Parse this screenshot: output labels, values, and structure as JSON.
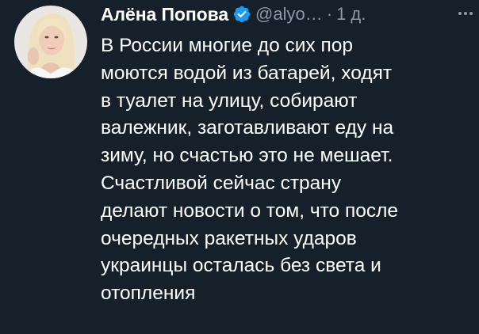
{
  "tweet": {
    "author": {
      "name": "Алёна Попова",
      "handle": "@alyo…",
      "verified": true,
      "avatar_icon": "profile-photo"
    },
    "separator": "·",
    "time": "1 д.",
    "more_icon": "more-horizontal-icon",
    "text_lines": [
      "В России многие до сих пор",
      "моются водой из батарей, ходят",
      "в туалет на улицу, собирают",
      "валежник, заготавливают еду на",
      "зиму, но счастью это не мешает.",
      "Счастливой сейчас страну",
      "делают новости о том, что после",
      "очередных ракетных ударов",
      "украинцы осталась без света и",
      "отопления"
    ]
  },
  "colors": {
    "background": "#15202b",
    "text": "#ffffff",
    "secondary_text": "#8b98a5",
    "verified_badge": "#1d9bf0"
  }
}
